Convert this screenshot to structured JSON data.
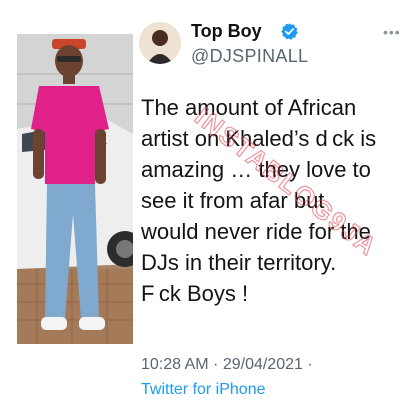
{
  "photo": {
    "description": "",
    "shirt_color": "#e0218a",
    "jeans_color": "#7fa9cf"
  },
  "tweet": {
    "author_name": "Top Boy",
    "handle": "@DJSPINALL",
    "verified_color": "#1d9bf0",
    "more_icon": "ellipsis-icon",
    "text": "The amount of African\nartist on Khaled’s d ck is\namazing … they love to\nsee it from afar but\nwould never ride for the\nDJs in their territory.\nF ck Boys !",
    "time": "10:28 AM · 29/04/2021 ·",
    "source": "Twitter for iPhone",
    "link_color": "#1d9bf0"
  },
  "watermark": {
    "text": "INSTABLOG9JA",
    "color": "#e03b4c"
  }
}
